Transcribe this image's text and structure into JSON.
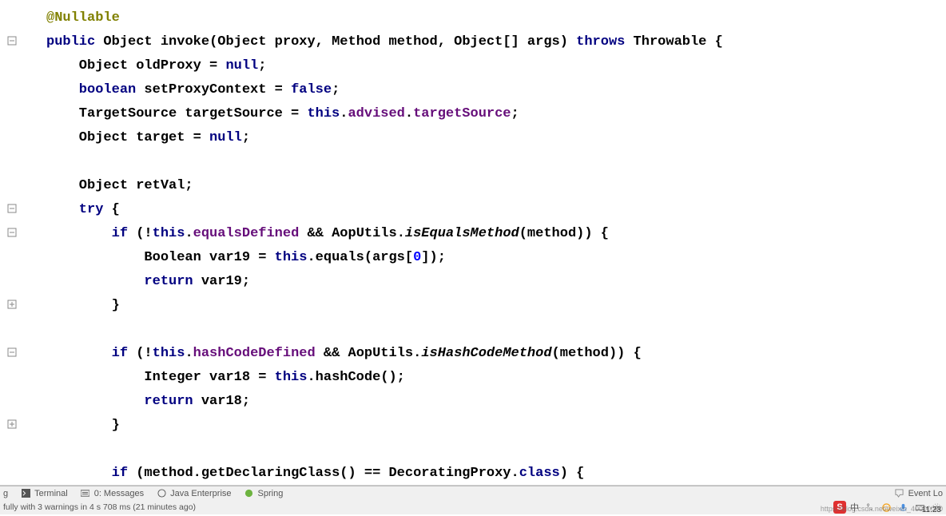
{
  "code": {
    "annotation": "@Nullable",
    "l1_kw_public": "public",
    "l1_object1": "Object ",
    "l1_invoke": "invoke",
    "l1_sig_rest": "(Object proxy, Method method, Object[] args) ",
    "l1_throws": "throws",
    "l1_throwable": " Throwable {",
    "l2": "    Object oldProxy = ",
    "l2_null": "null",
    "l2_end": ";",
    "l3_kw": "    boolean",
    "l3_mid": " setProxyContext = ",
    "l3_false": "false",
    "l3_end": ";",
    "l4_a": "    TargetSource targetSource = ",
    "l4_this": "this",
    "l4_b": ".",
    "l4_advised": "advised",
    "l4_c": ".",
    "l4_ts": "targetSource",
    "l4_end": ";",
    "l5_a": "    Object target = ",
    "l5_null": "null",
    "l5_end": ";",
    "l6": "",
    "l7": "    Object retVal;",
    "l8_try": "    try",
    "l8_brace": " {",
    "l9_if": "        if",
    "l9_a": " (!",
    "l9_this": "this",
    "l9_b": ".",
    "l9_eq": "equalsDefined",
    "l9_c": " && AopUtils.",
    "l9_iseq": "isEqualsMethod",
    "l9_d": "(method)) {",
    "l10_a": "            Boolean var19 = ",
    "l10_this": "this",
    "l10_b": ".equals(args[",
    "l10_zero": "0",
    "l10_c": "]);",
    "l11_ret": "            return",
    "l11_var": " var19;",
    "l12": "        }",
    "l13": "",
    "l14_if": "        if",
    "l14_a": " (!",
    "l14_this": "this",
    "l14_b": ".",
    "l14_hc": "hashCodeDefined",
    "l14_c": " && AopUtils.",
    "l14_ishc": "isHashCodeMethod",
    "l14_d": "(method)) {",
    "l15_a": "            Integer var18 = ",
    "l15_this": "this",
    "l15_b": ".hashCode();",
    "l16_ret": "            return",
    "l16_var": " var18;",
    "l17": "        }",
    "l18": "",
    "l19_if": "        if",
    "l19_a": " (method.getDeclaringClass() == DecoratingProxy.",
    "l19_class": "class",
    "l19_b": ") {"
  },
  "bottom": {
    "g": "g",
    "terminal": "Terminal",
    "messages": "0: Messages",
    "java_enterprise": "Java Enterprise",
    "spring": "Spring",
    "event_log": "Event Lo"
  },
  "status": {
    "build_msg": "fully with 3 warnings in 4 s 708 ms (21 minutes ago)"
  },
  "tray": {
    "s_icon": "S",
    "ime": "中",
    "time": "11:23"
  },
  "watermark": "https://blog.csdn.net/weixin_40000000"
}
